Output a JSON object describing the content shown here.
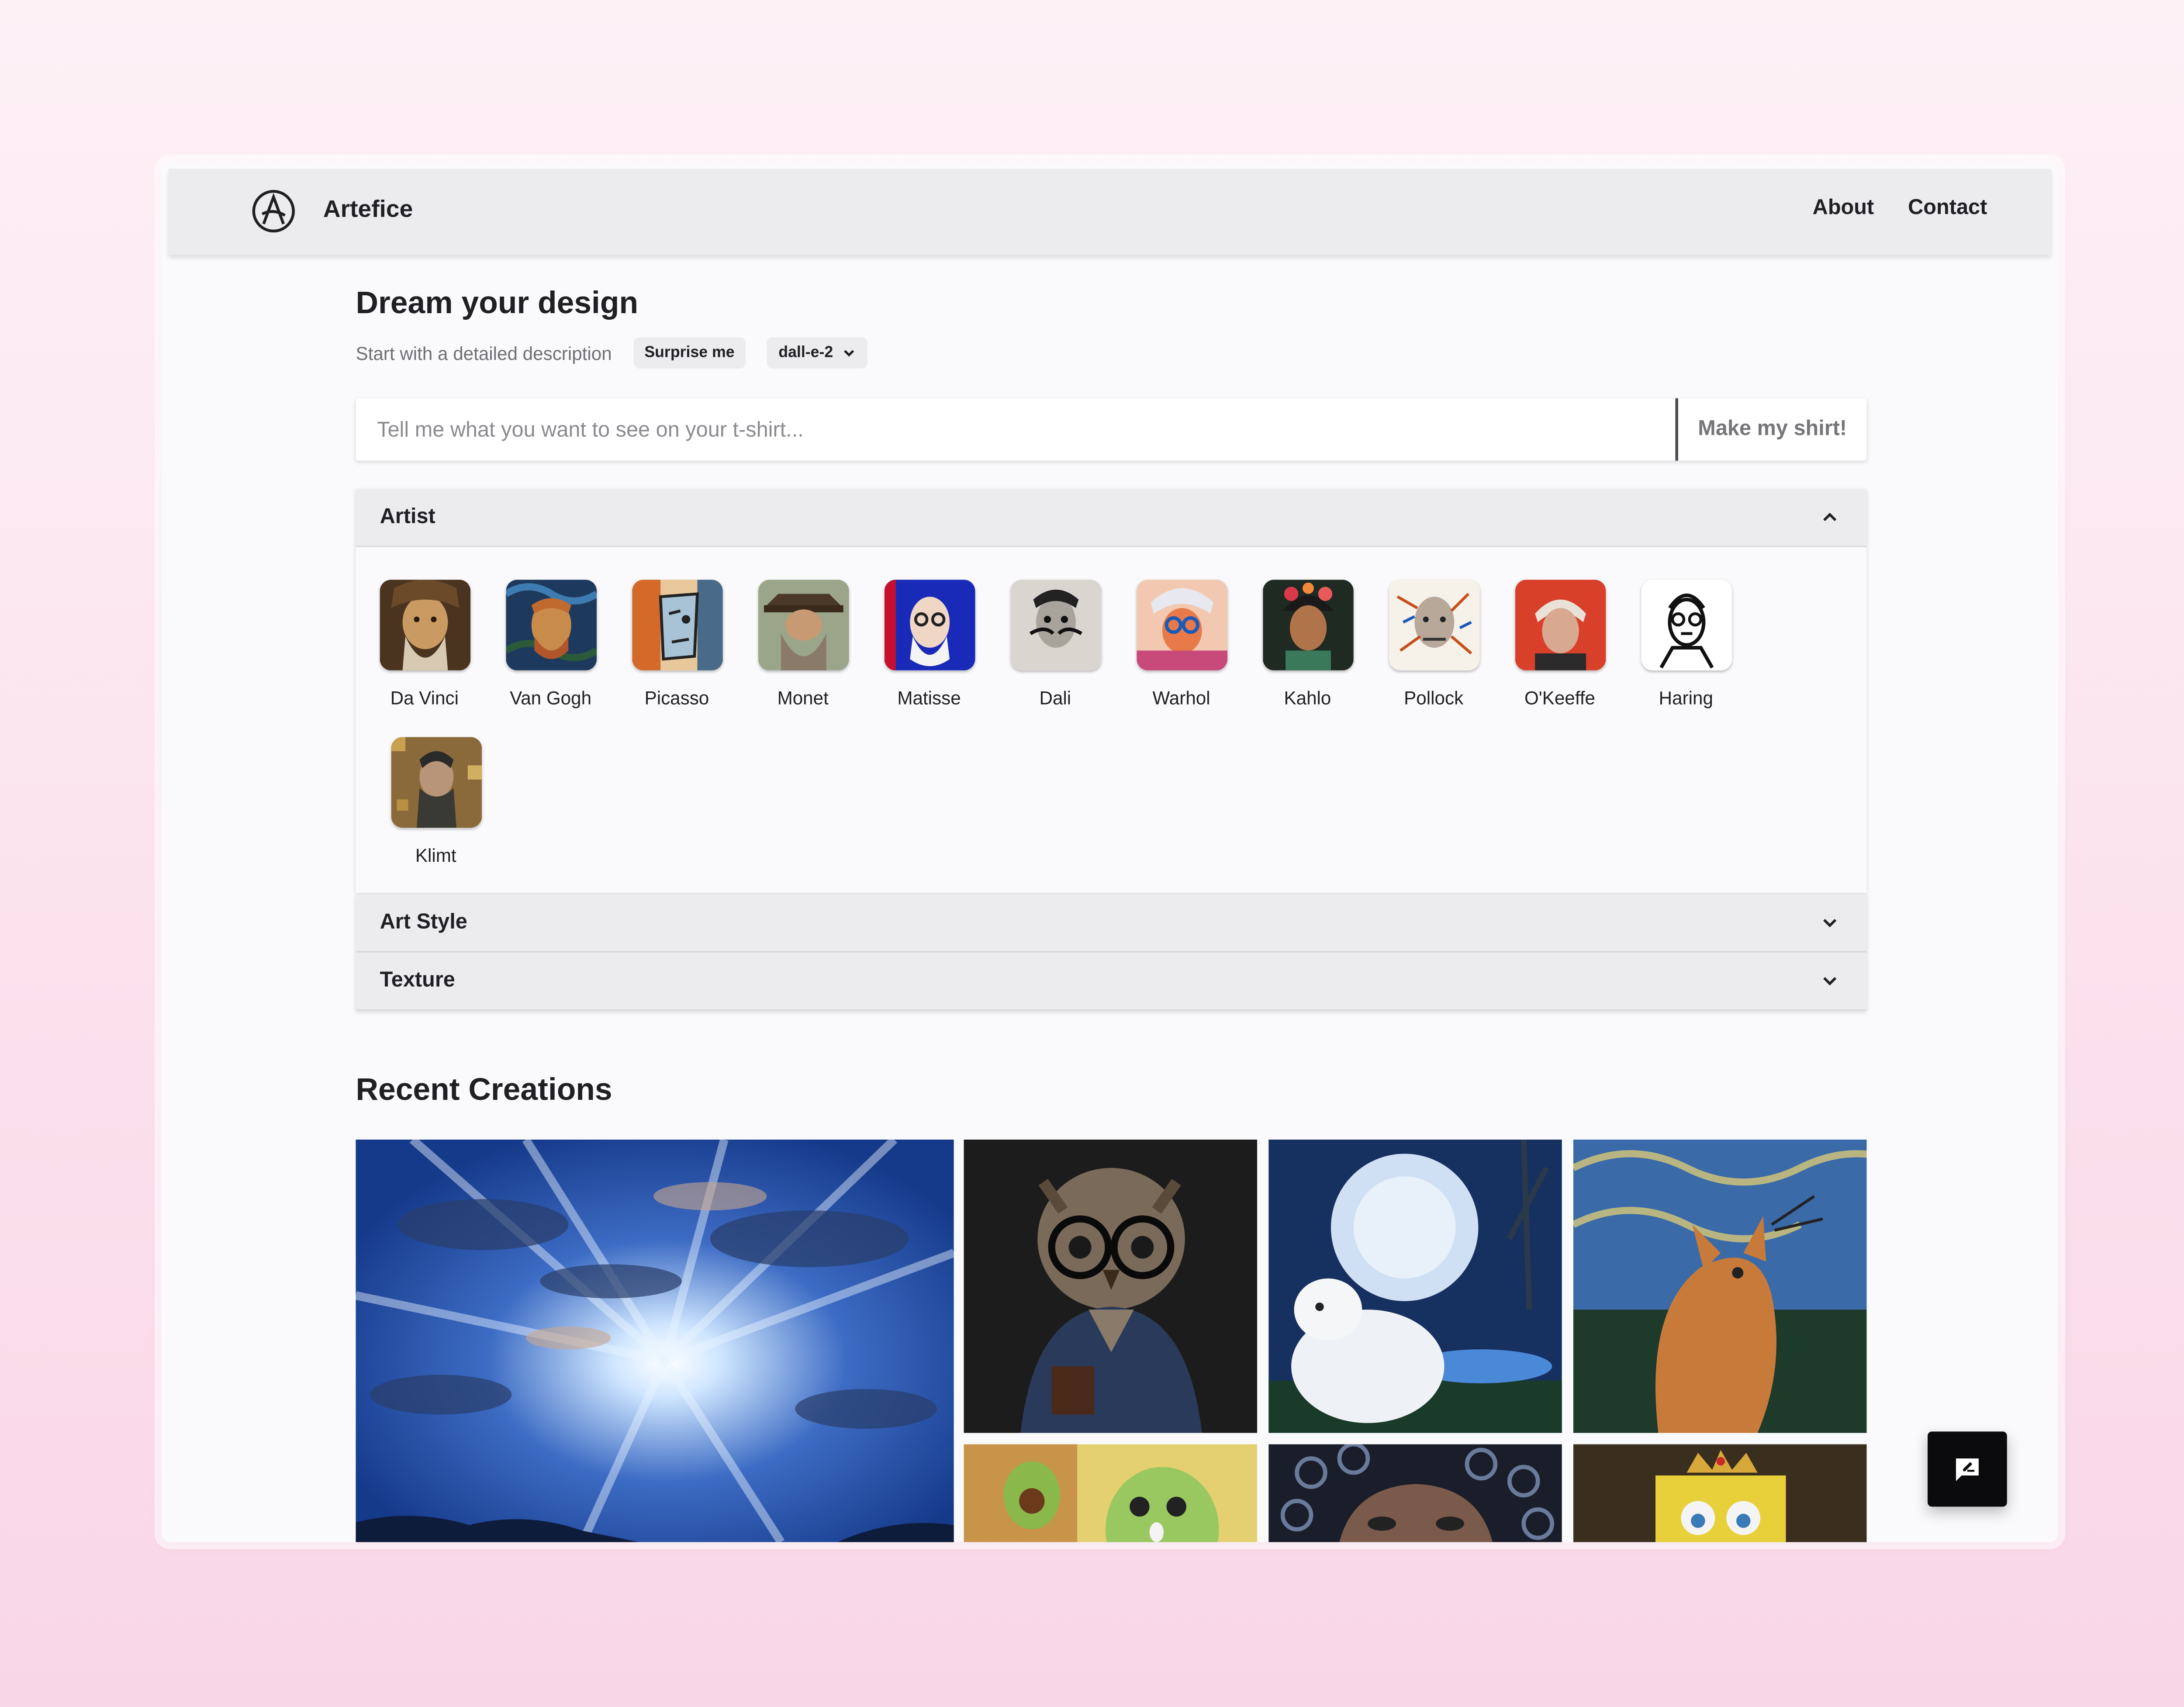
{
  "nav": {
    "brand": "Artefice",
    "links": [
      "About",
      "Contact"
    ]
  },
  "hero": {
    "title": "Dream your design",
    "subtitle": "Start with a detailed description",
    "surprise_label": "Surprise me",
    "model_select": "dall-e-2"
  },
  "prompt": {
    "placeholder": "Tell me what you want to see on your t-shirt...",
    "value": "",
    "submit_label": "Make my shirt!"
  },
  "sections": {
    "artist": {
      "label": "Artist",
      "expanded": true
    },
    "art_style": {
      "label": "Art Style",
      "expanded": false
    },
    "texture": {
      "label": "Texture",
      "expanded": false
    }
  },
  "artists": [
    "Da Vinci",
    "Van Gogh",
    "Picasso",
    "Monet",
    "Matisse",
    "Dali",
    "Warhol",
    "Kahlo",
    "Pollock",
    "O'Keeffe",
    "Haring",
    "Klimt"
  ],
  "recent": {
    "title": "Recent Creations"
  },
  "colors": {
    "accent_dark": "#0b0b0d",
    "nav_bg": "#ececef",
    "background_top": "#fdf1f6",
    "background_bottom": "#f9d6e6"
  },
  "icons": {
    "logo": "circled-a-logo",
    "chat": "chat-feedback-icon"
  }
}
